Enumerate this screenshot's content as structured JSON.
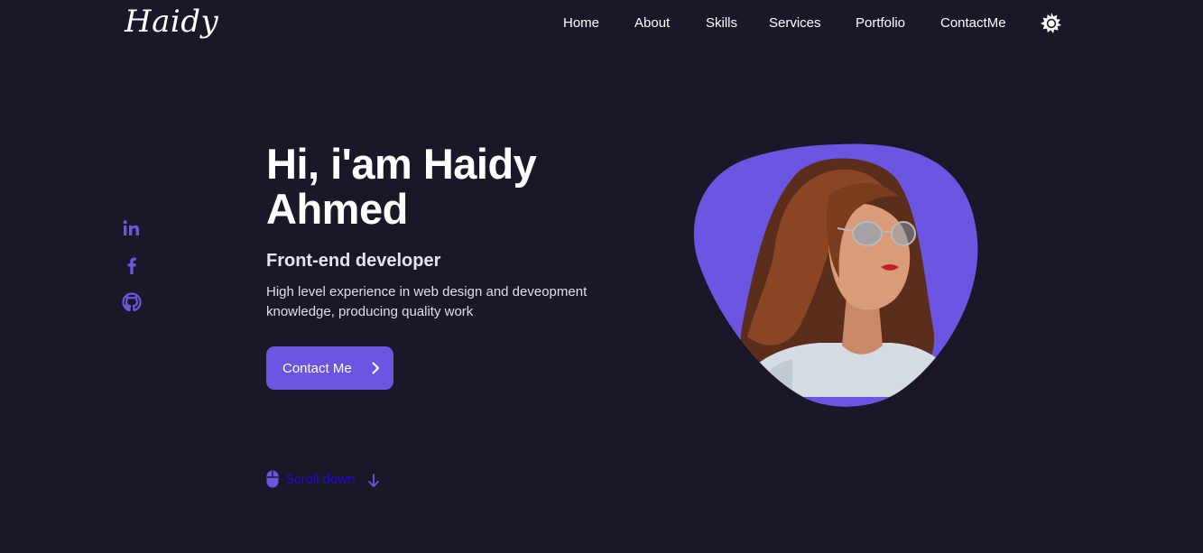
{
  "header": {
    "logo": "Haidy",
    "nav": [
      "Home",
      "About",
      "Skills",
      "Services",
      "Portfolio",
      "ContactMe"
    ],
    "theme_toggle_icon": "sun-icon"
  },
  "social": {
    "icons": [
      "linkedin-icon",
      "facebook-icon",
      "github-icon"
    ]
  },
  "hero": {
    "title_line1": "Hi, i'am Haidy",
    "title_line2": "Ahmed",
    "subtitle": "Front-end developer",
    "description": "High level experience in web design and deveopment knowledge, producing quality work",
    "contact_button": "Contact Me",
    "scroll_down": "Scroll down"
  },
  "colors": {
    "background": "#1b1728",
    "accent": "#6c55e0",
    "scroll_text": "#1f0cd6"
  }
}
